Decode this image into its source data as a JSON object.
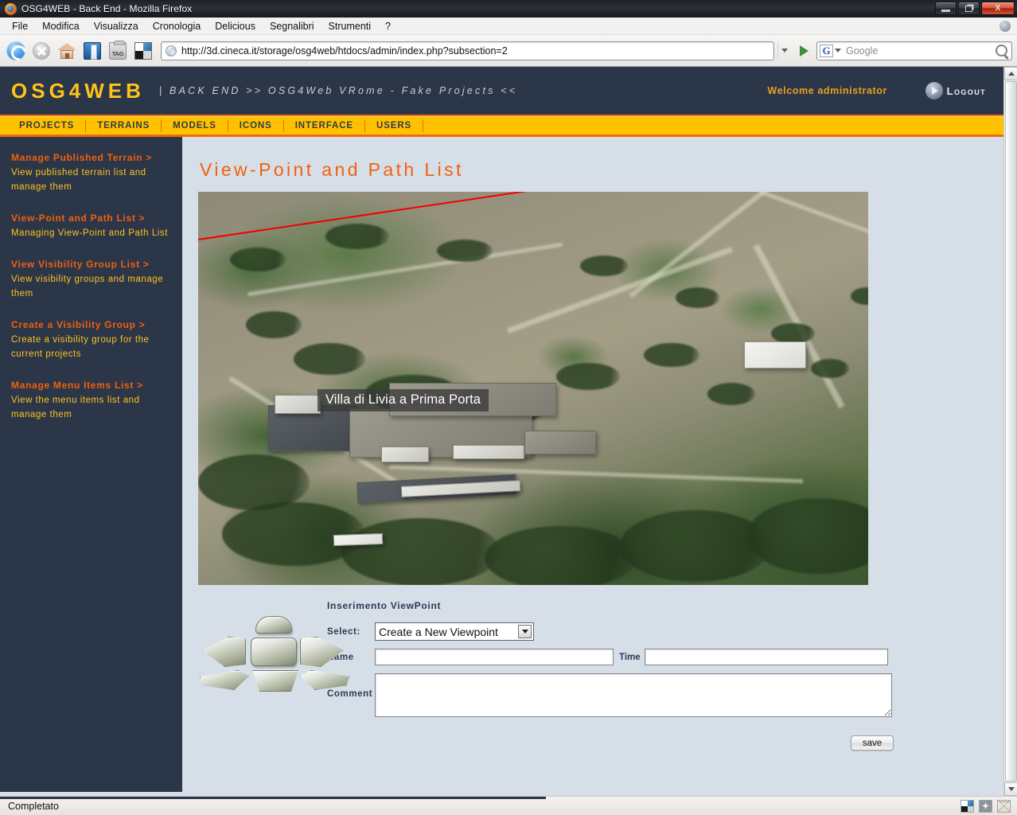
{
  "browser": {
    "window_title": "OSG4WEB - Back End - Mozilla Firefox",
    "menus": [
      "File",
      "Modifica",
      "Visualizza",
      "Cronologia",
      "Delicious",
      "Segnalibri",
      "Strumenti",
      "?"
    ],
    "url": "http://3d.cineca.it/storage/osg4web/htdocs/admin/index.php?subsection=2",
    "search_engine": "G",
    "search_placeholder": "Google",
    "status_text": "Completato",
    "window_buttons": {
      "minimize": "_",
      "restore": "❐",
      "close": "X"
    }
  },
  "site": {
    "brand": "OSG4WEB",
    "brand_subtitle": "| BACK END >> OSG4Web VRome - Fake Projects <<",
    "welcome": "Welcome administrator",
    "logout_label": "Logout",
    "nav_tabs": [
      "PROJECTS",
      "TERRAINS",
      "MODELS",
      "ICONS",
      "INTERFACE",
      "USERS"
    ],
    "accent_orange": "#f2600c",
    "accent_yellow": "#ffc200",
    "header_navy": "#2b3649"
  },
  "sidebar": {
    "items": [
      {
        "title": "Manage Published Terrain >",
        "desc": "View published terrain list and manage them"
      },
      {
        "title": "View-Point and Path List >",
        "desc": "Managing View-Point and Path List"
      },
      {
        "title": "View Visibility Group List >",
        "desc": "View visibility groups and manage them"
      },
      {
        "title": "Create a Visibility Group >",
        "desc": "Create a visibility group for the current projects"
      },
      {
        "title": "Manage Menu Items List >",
        "desc": "View the menu items list and manage them"
      }
    ]
  },
  "main": {
    "page_title": "View-Point and Path List",
    "photo_label": "Villa di Livia a Prima Porta",
    "form": {
      "title": "Inserimento ViewPoint",
      "select_label": "Select:",
      "select_value": "Create a New Viewpoint",
      "select_options": [
        "Create a New Viewpoint"
      ],
      "name_label": "Name",
      "name_value": "",
      "time_label": "Time",
      "time_value": "",
      "comment_label": "Comment",
      "comment_value": "",
      "save_label": "save"
    }
  }
}
